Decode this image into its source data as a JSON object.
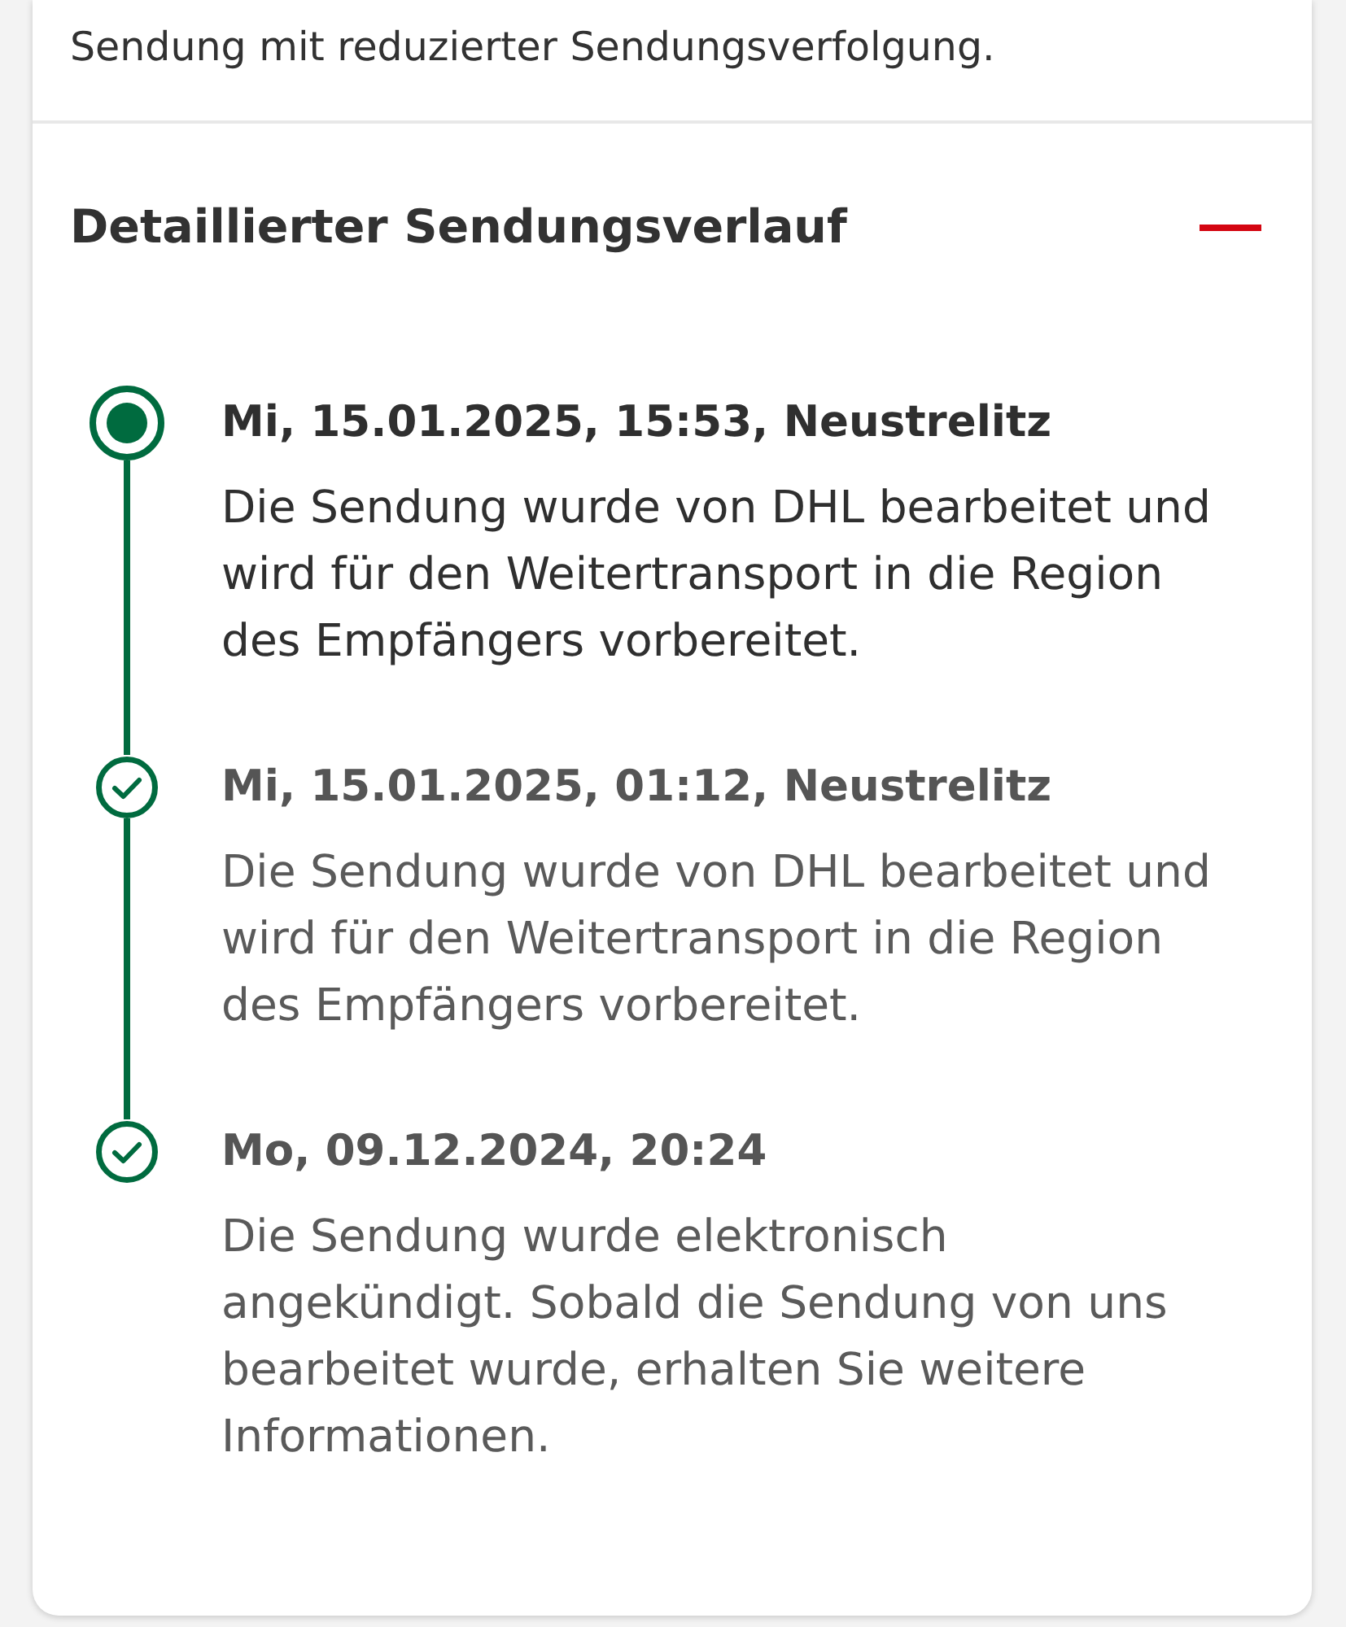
{
  "notice": {
    "text": "Sendung mit reduzierter Sendungsverfolgung."
  },
  "history": {
    "title": "Detaillierter Sendungsverlauf",
    "expanded": true,
    "events": [
      {
        "title": "Mi, 15.01.2025, 15:53, Neustrelitz",
        "description": "Die Sendung wurde von DHL bearbeitet und wird für den Weitertransport in die Region des Empfängers vorbereitet.",
        "current": true
      },
      {
        "title": "Mi, 15.01.2025, 01:12, Neustrelitz",
        "description": "Die Sendung wurde von DHL bearbeitet und wird für den Weitertransport in die Region des Empfängers vorbereitet.",
        "current": false
      },
      {
        "title": "Mo, 09.12.2024, 20:24",
        "description": "Die Sendung wurde elektronisch angekündigt. Sobald die Sendung von uns bearbeitet wurde, erhalten Sie weitere Informationen.",
        "current": false
      }
    ]
  }
}
